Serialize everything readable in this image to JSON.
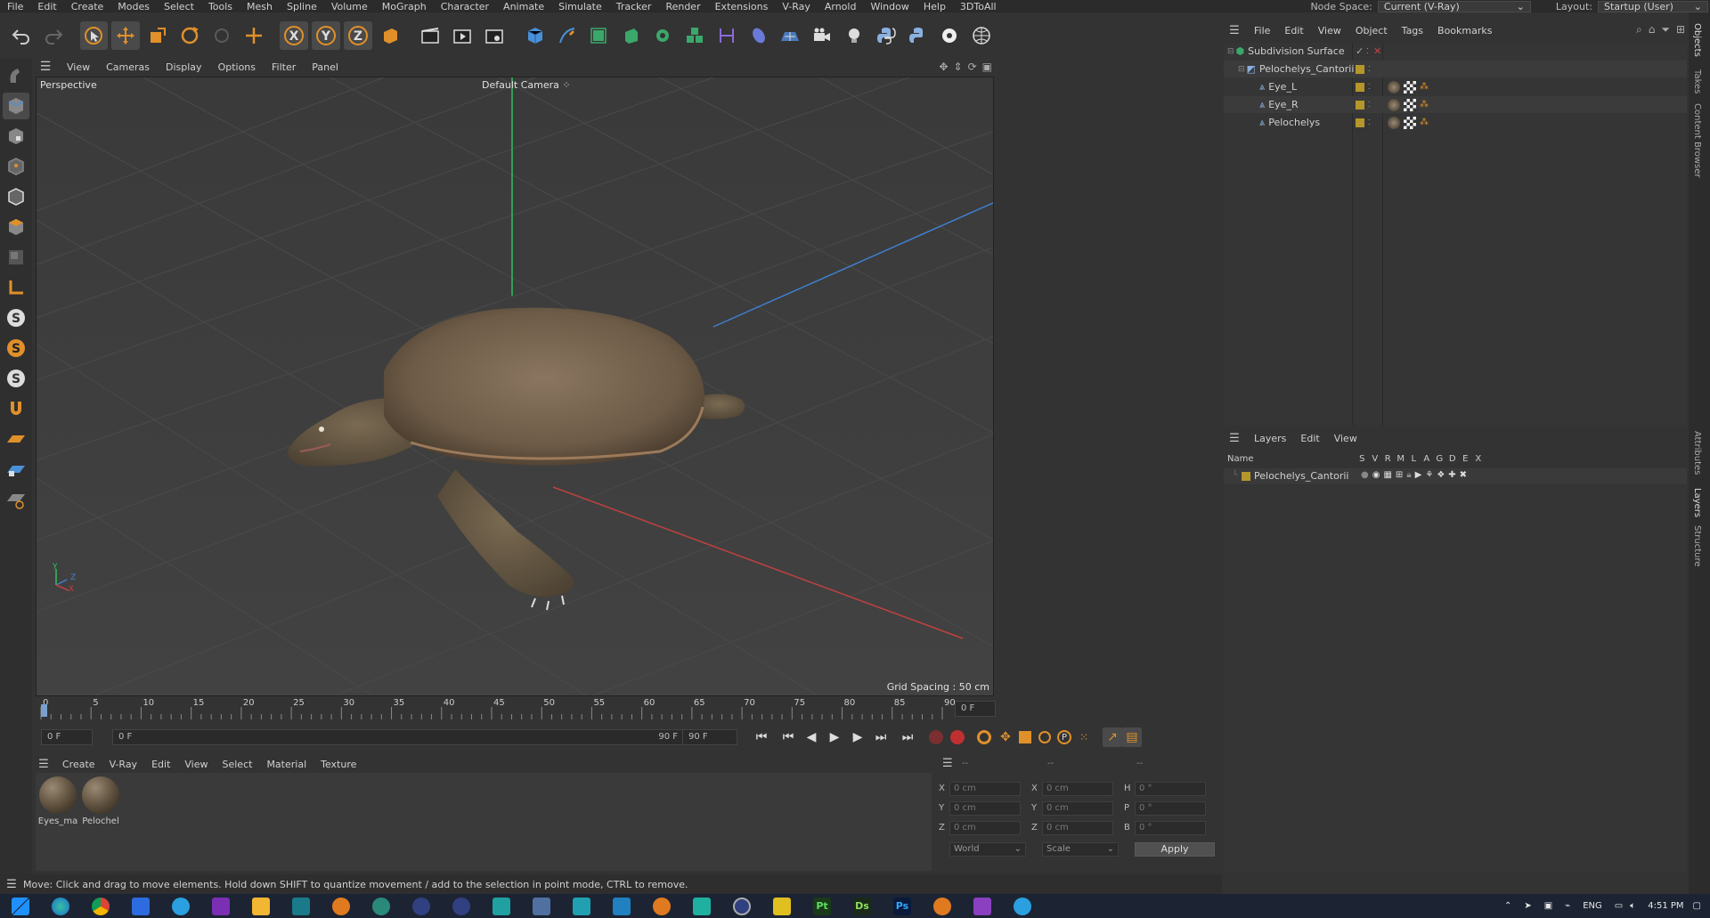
{
  "menubar": {
    "items": [
      "File",
      "Edit",
      "Create",
      "Modes",
      "Select",
      "Tools",
      "Mesh",
      "Spline",
      "Volume",
      "MoGraph",
      "Character",
      "Animate",
      "Simulate",
      "Tracker",
      "Render",
      "Extensions",
      "V-Ray",
      "Arnold",
      "Window",
      "Help",
      "3DToAll"
    ],
    "node_space_label": "Node Space:",
    "node_space_value": "Current (V-Ray)",
    "layout_label": "Layout:",
    "layout_value": "Startup (User)"
  },
  "viewport": {
    "menu": [
      "View",
      "Cameras",
      "Display",
      "Options",
      "Filter",
      "Panel"
    ],
    "view_name": "Perspective",
    "camera_name": "Default Camera",
    "grid_spacing": "Grid Spacing : 50 cm",
    "axis_y": "Y",
    "axis_z": "Z",
    "axis_x": "X"
  },
  "timeline": {
    "ticks": [
      "0",
      "5",
      "10",
      "15",
      "20",
      "25",
      "30",
      "35",
      "40",
      "45",
      "50",
      "55",
      "60",
      "65",
      "70",
      "75",
      "80",
      "85",
      "90"
    ],
    "current_frame_field": "0 F",
    "start_field": "0 F",
    "range_start": "0 F",
    "range_end": "90 F",
    "end_field": "90 F",
    "max_frames": 90
  },
  "materials": {
    "menu": [
      "Create",
      "V-Ray",
      "Edit",
      "View",
      "Select",
      "Material",
      "Texture"
    ],
    "items": [
      {
        "name": "Eyes_ma"
      },
      {
        "name": "Pelochel"
      }
    ]
  },
  "coords": {
    "header": [
      "--",
      "--",
      "--"
    ],
    "rows": [
      {
        "l1": "X",
        "v1": "0 cm",
        "l2": "X",
        "v2": "0 cm",
        "l3": "H",
        "v3": "0 °"
      },
      {
        "l1": "Y",
        "v1": "0 cm",
        "l2": "Y",
        "v2": "0 cm",
        "l3": "P",
        "v3": "0 °"
      },
      {
        "l1": "Z",
        "v1": "0 cm",
        "l2": "Z",
        "v2": "0 cm",
        "l3": "B",
        "v3": "0 °"
      }
    ],
    "world": "World",
    "scale": "Scale",
    "apply": "Apply"
  },
  "status": "Move: Click and drag to move elements. Hold down SHIFT to quantize movement / add to the selection in point mode, CTRL to remove.",
  "objects": {
    "menu": [
      "File",
      "Edit",
      "View",
      "Object",
      "Tags",
      "Bookmarks"
    ],
    "items": [
      {
        "name": "Subdivision Surface",
        "indent": 0
      },
      {
        "name": "Pelochelys_Cantorii",
        "indent": 1
      },
      {
        "name": "Eye_L",
        "indent": 2
      },
      {
        "name": "Eye_R",
        "indent": 2
      },
      {
        "name": "Pelochelys",
        "indent": 2
      }
    ]
  },
  "layers": {
    "menu": [
      "Layers",
      "Edit",
      "View"
    ],
    "header_name": "Name",
    "header_cols": [
      "S",
      "V",
      "R",
      "M",
      "L",
      "A",
      "G",
      "D",
      "E",
      "X"
    ],
    "items": [
      {
        "name": "Pelochelys_Cantorii"
      }
    ]
  },
  "right_tabs": [
    "Objects",
    "Takes",
    "Content Browser",
    "Attributes",
    "Layers",
    "Structure"
  ],
  "tray": {
    "lang": "ENG",
    "time": "4:51 PM"
  },
  "colors": {
    "layer_color": "#b5962a",
    "axis_x": "#c04040",
    "axis_y": "#30c060",
    "axis_z": "#4080d0",
    "tag_orange": "#e0902a"
  }
}
